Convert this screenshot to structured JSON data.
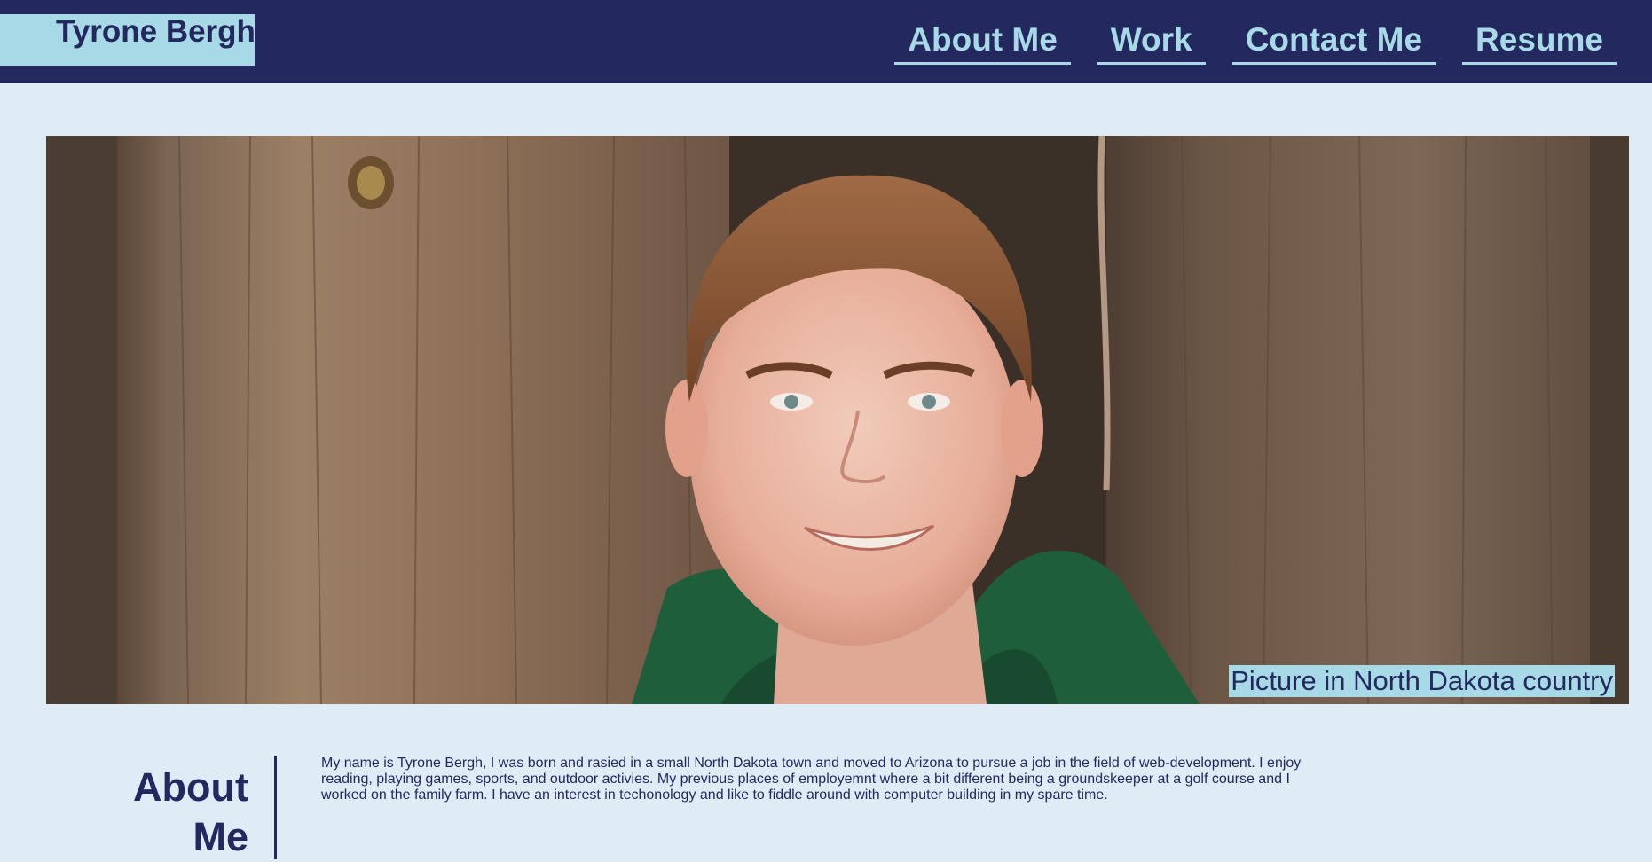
{
  "header": {
    "brand": "Tyrone Bergh",
    "nav": [
      {
        "label": "About Me"
      },
      {
        "label": "Work"
      },
      {
        "label": "Contact Me"
      },
      {
        "label": "Resume"
      }
    ]
  },
  "hero": {
    "caption": "Picture in North Dakota country"
  },
  "about": {
    "heading": "About Me",
    "text": "My name is Tyrone Bergh, I was born and rasied in a small North Dakota town and moved to Arizona to pursue a job in the field of web-development. I enjoy reading, playing games, sports, and outdoor activies. My previous places of employemnt where a bit different being a groundskeeper at a golf course and I worked on the family farm. I have an interest in techonology and like to fiddle around with computer building in my spare time."
  },
  "colors": {
    "header_bg": "#23295e",
    "accent": "#a8d9e6",
    "page_bg": "#dfecf6",
    "text": "#23295e"
  }
}
